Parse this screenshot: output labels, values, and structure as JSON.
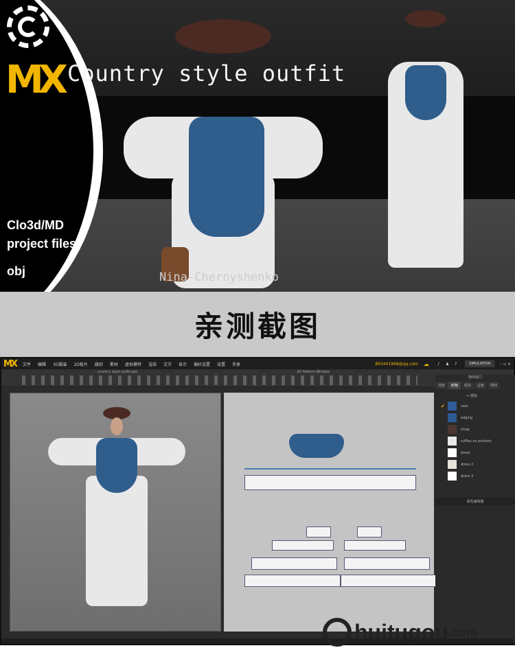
{
  "banner": {
    "title": "Country style outfit",
    "logo_text": "CMD",
    "line1": "Clo3d/MD",
    "line2": "project files",
    "line3": "obj",
    "author": "Nina-Chernyshenko"
  },
  "caption": "亲测截图",
  "app": {
    "menu": [
      "文件",
      "编辑",
      "3D服装",
      "2D板片",
      "缝纫",
      "素材",
      "虚拟模特",
      "渲染",
      "文字",
      "显示",
      "偏好设置",
      "设置",
      "手册"
    ],
    "file_title": "country style outfit.zprj",
    "pattern_window": "2D Pattern Window",
    "email": "893441968@qq.com",
    "mode": "SIMULATION",
    "object_window": "物体窗口",
    "tabs": [
      "场景",
      "织物",
      "纽扣",
      "拉链",
      "明线"
    ],
    "add_label": "+ 增加",
    "fabrics": [
      {
        "name": "vest",
        "color": "#2f5d9a"
      },
      {
        "name": "edging",
        "color": "#2c5a95"
      },
      {
        "name": "strap",
        "color": "#4b3632"
      },
      {
        "name": "ruffles on pockets",
        "color": "#e8e8e8"
      },
      {
        "name": "dress",
        "color": "#ffffff"
      },
      {
        "name": "dress 2",
        "color": "#e6e4da"
      },
      {
        "name": "dress 3",
        "color": "#ffffff"
      }
    ],
    "properties": "属性编辑器"
  },
  "watermark": {
    "brand": "huitugou",
    "tld": ".com"
  }
}
